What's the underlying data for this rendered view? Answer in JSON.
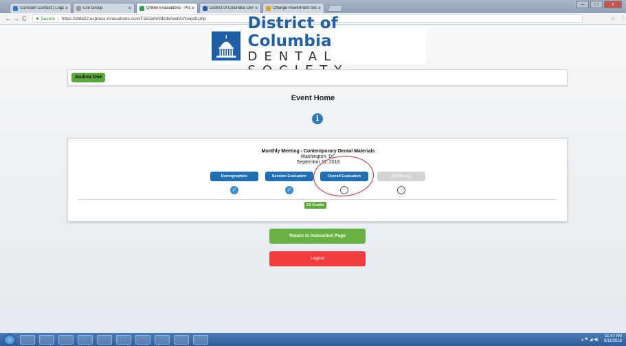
{
  "browser": {
    "tabs": [
      {
        "title": "Constant Contact | Logo",
        "favicon_color": "#2a7bd0",
        "active": false
      },
      {
        "title": "Lire Group",
        "favicon_color": "#999999",
        "active": false
      },
      {
        "title": "Online Evaluations - Pro",
        "favicon_color": "#2e9e4f",
        "active": true
      },
      {
        "title": "District of Columbia Den",
        "favicon_color": "#1f5fa8",
        "active": false
      },
      {
        "title": "Change PowerPoint Slid",
        "favicon_color": "#e0a21b",
        "active": false
      }
    ],
    "tab_close_glyph": "×",
    "window_controls": {
      "minimize": "−",
      "maximize": "□",
      "close": "×"
    },
    "nav": {
      "back": "←",
      "forward": "→",
      "reload": "C"
    },
    "secure_label": "Secure",
    "url": "https://data02.express-evaluations.com/F562a0ef/dcds/web/showjob.php",
    "menu_glyph": "⋮"
  },
  "logo": {
    "line1": "District of Columbia",
    "line2": "DENTAL SOCIETY"
  },
  "user": {
    "name": "Andrea Doe"
  },
  "page": {
    "title": "Event Home",
    "info_icon_glyph": "i"
  },
  "event": {
    "title": "Monthly Meeting - Contemporary Dental Materials",
    "location": "Washington, DC",
    "date": "September 11, 2018",
    "credits": "2.0 Credits"
  },
  "steps": [
    {
      "label": "Demographics",
      "status": "complete",
      "enabled": true
    },
    {
      "label": "Session Evaluation",
      "status": "complete",
      "enabled": true
    },
    {
      "label": "Overall Evaluation",
      "status": "incomplete",
      "enabled": true
    },
    {
      "label": "Certificate",
      "status": "incomplete",
      "enabled": false
    }
  ],
  "check_glyph": "✓",
  "actions": {
    "return_label": "Return to Instruction Page",
    "logout_label": "Logout"
  },
  "taskbar": {
    "apps": [
      "IE",
      "Chrome",
      "Media",
      "Folder",
      "Edge",
      "Outlook",
      "Word",
      "PowerPoint",
      "Excel",
      "Paint"
    ],
    "time": "11:47 AM",
    "date": "9/11/2018"
  },
  "colors": {
    "brand_blue": "#1f5fa8",
    "step_blue": "#1f6fb5",
    "green": "#5aa838",
    "red": "#f03c3c",
    "annotation_red": "#c8282c"
  }
}
